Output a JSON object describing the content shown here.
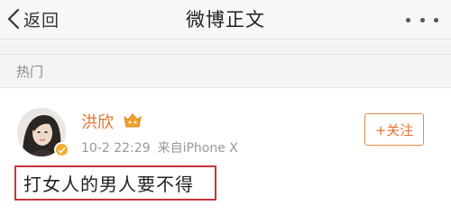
{
  "navbar": {
    "back_label": "返回",
    "title": "微博正文",
    "more_icon": "more-dots-icon"
  },
  "section": {
    "label": "热门"
  },
  "post": {
    "author": "洪欣",
    "vip_icon": "vip-crown-icon",
    "verified_icon": "verified-badge-icon",
    "date": "10-2 22:29",
    "source": "来自iPhone X",
    "follow_label": "+关注",
    "text": "打女人的男人要不得"
  },
  "colors": {
    "accent": "#e8702a",
    "highlight_box": "#c3363a",
    "badge": "#f4ab2c"
  }
}
